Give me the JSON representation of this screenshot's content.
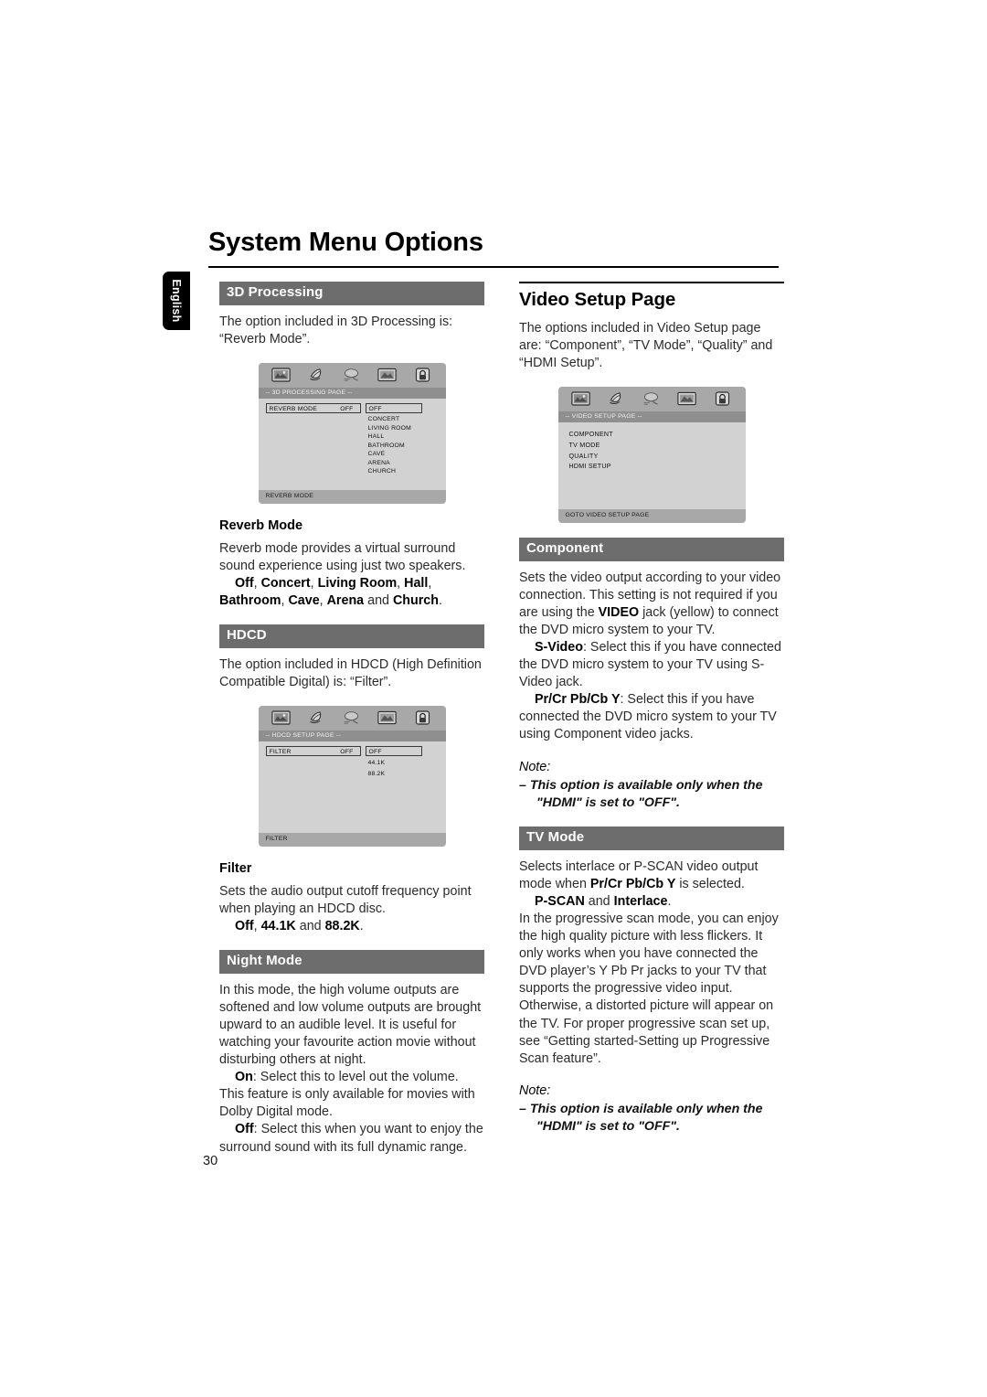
{
  "page": {
    "title": "System Menu Options",
    "language_tab": "English",
    "number": "30",
    "accent_bar_color": "#6d6d6d",
    "osd_background_color": "#d2d2d2"
  },
  "left_column": {
    "section_3d": {
      "heading": "3D Processing",
      "intro": "The option included in 3D Processing is: “Reverb Mode”."
    },
    "osd_3d": {
      "page_title": "-- 3D PROCESSING PAGE --",
      "row_label": "REVERB MODE",
      "row_value": "OFF",
      "selected_option": "OFF",
      "options": [
        "CONCERT",
        "LIVING ROOM",
        "HALL",
        "BATHROOM",
        "CAVE",
        "ARENA",
        "CHURCH"
      ],
      "footer": "REVERB MODE",
      "icons": [
        "general-setup-icon",
        "audio-setup-icon",
        "preference-icon",
        "video-setup-icon",
        "password-lock-icon"
      ]
    },
    "reverb": {
      "heading": "Reverb Mode",
      "para1": "Reverb mode provides a virtual surround sound experience using just two speakers.",
      "options_line_parts": [
        {
          "t": "Off",
          "b": true
        },
        {
          "t": ", ",
          "b": false
        },
        {
          "t": "Concert",
          "b": true
        },
        {
          "t": ", ",
          "b": false
        },
        {
          "t": "Living Room",
          "b": true
        },
        {
          "t": ", ",
          "b": false
        },
        {
          "t": "Hall",
          "b": true
        },
        {
          "t": ", ",
          "b": false
        },
        {
          "t": "Bathroom",
          "b": true
        },
        {
          "t": ", ",
          "b": false
        },
        {
          "t": "Cave",
          "b": true
        },
        {
          "t": ", ",
          "b": false
        },
        {
          "t": "Arena",
          "b": true
        },
        {
          "t": " and ",
          "b": false
        },
        {
          "t": "Church",
          "b": true
        },
        {
          "t": ".",
          "b": false
        }
      ]
    },
    "section_hdcd": {
      "heading": "HDCD",
      "intro": "The option included in HDCD (High Definition Compatible Digital) is: “Filter”."
    },
    "osd_hdcd": {
      "page_title": "-- HDCD SETUP PAGE --",
      "row_label": "FILTER",
      "row_value": "OFF",
      "selected_option": "OFF",
      "options": [
        "44.1K",
        "88.2K"
      ],
      "footer": "FILTER",
      "icons": [
        "general-setup-icon",
        "audio-setup-icon",
        "preference-icon",
        "video-setup-icon",
        "password-lock-icon"
      ]
    },
    "filter": {
      "heading": "Filter",
      "para1": "Sets the audio output cutoff frequency point when playing an HDCD disc.",
      "options_line_parts": [
        {
          "t": "Off",
          "b": true
        },
        {
          "t": ", ",
          "b": false
        },
        {
          "t": "44.1K",
          "b": true
        },
        {
          "t": " and ",
          "b": false
        },
        {
          "t": "88.2K",
          "b": true
        },
        {
          "t": ".",
          "b": false
        }
      ]
    },
    "night_mode": {
      "heading": "Night Mode",
      "para1": "In this mode, the high volume outputs are softened and low volume outputs are brought upward to an audible level. It is useful for watching your favourite action movie without disturbing others at night.",
      "on_parts": [
        {
          "t": "On",
          "b": true
        },
        {
          "t": ": Select this to level out the volume. This feature is only available for movies with Dolby Digital mode.",
          "b": false
        }
      ],
      "off_parts": [
        {
          "t": "Off",
          "b": true
        },
        {
          "t": ": Select this when you want to enjoy the surround sound with its full dynamic range.",
          "b": false
        }
      ]
    }
  },
  "right_column": {
    "video_setup": {
      "heading": "Video Setup Page",
      "intro": "The options included in Video Setup page are: “Component”, “TV Mode”, “Quality” and “HDMI Setup”."
    },
    "osd_video": {
      "page_title": "-- VIDEO SETUP PAGE --",
      "menu_items": [
        "COMPONENT",
        "TV MODE",
        "QUALITY",
        "HDMI SETUP"
      ],
      "footer": "GOTO VIDEO SETUP PAGE",
      "icons": [
        "general-setup-icon",
        "audio-setup-icon",
        "preference-icon",
        "video-setup-icon",
        "password-lock-icon"
      ]
    },
    "component": {
      "heading": "Component",
      "para1_parts": [
        {
          "t": "Sets the video output according to your video connection. This setting is not required if you are using the ",
          "b": false
        },
        {
          "t": "VIDEO",
          "b": true
        },
        {
          "t": " jack (yellow) to connect the DVD micro system to your TV.",
          "b": false
        }
      ],
      "svideo_parts": [
        {
          "t": "S-Video",
          "b": true
        },
        {
          "t": ": Select this if you have connected the DVD micro system to your TV using S-Video jack.",
          "b": false
        }
      ],
      "component_parts": [
        {
          "t": "Pr/Cr Pb/Cb Y",
          "b": true
        },
        {
          "t": ": Select this if you have connected the DVD micro system to your TV using Component video jacks.",
          "b": false
        }
      ],
      "note_label": "Note:",
      "note_text": "–  This option is available only when the \"HDMI\" is set to \"OFF\"."
    },
    "tv_mode": {
      "heading": "TV Mode",
      "para1_parts": [
        {
          "t": "Selects interlace or P-SCAN video output mode when ",
          "b": false
        },
        {
          "t": "Pr/Cr Pb/Cb Y",
          "b": true
        },
        {
          "t": " is selected.",
          "b": false
        }
      ],
      "options_line_parts": [
        {
          "t": "P-SCAN",
          "b": true
        },
        {
          "t": " and ",
          "b": false
        },
        {
          "t": "Interlace",
          "b": true
        },
        {
          "t": ".",
          "b": false
        }
      ],
      "para2": "In the progressive scan mode, you can enjoy the high quality picture with less flickers. It only works when you have connected the DVD player’s Y Pb Pr jacks to your TV that supports the progressive video input. Otherwise, a distorted picture will appear on the TV. For proper progressive scan set up, see “Getting started-Setting up Progressive Scan feature”.",
      "note_label": "Note:",
      "note_text": "–  This option is available only when the \"HDMI\" is set to \"OFF\"."
    }
  }
}
